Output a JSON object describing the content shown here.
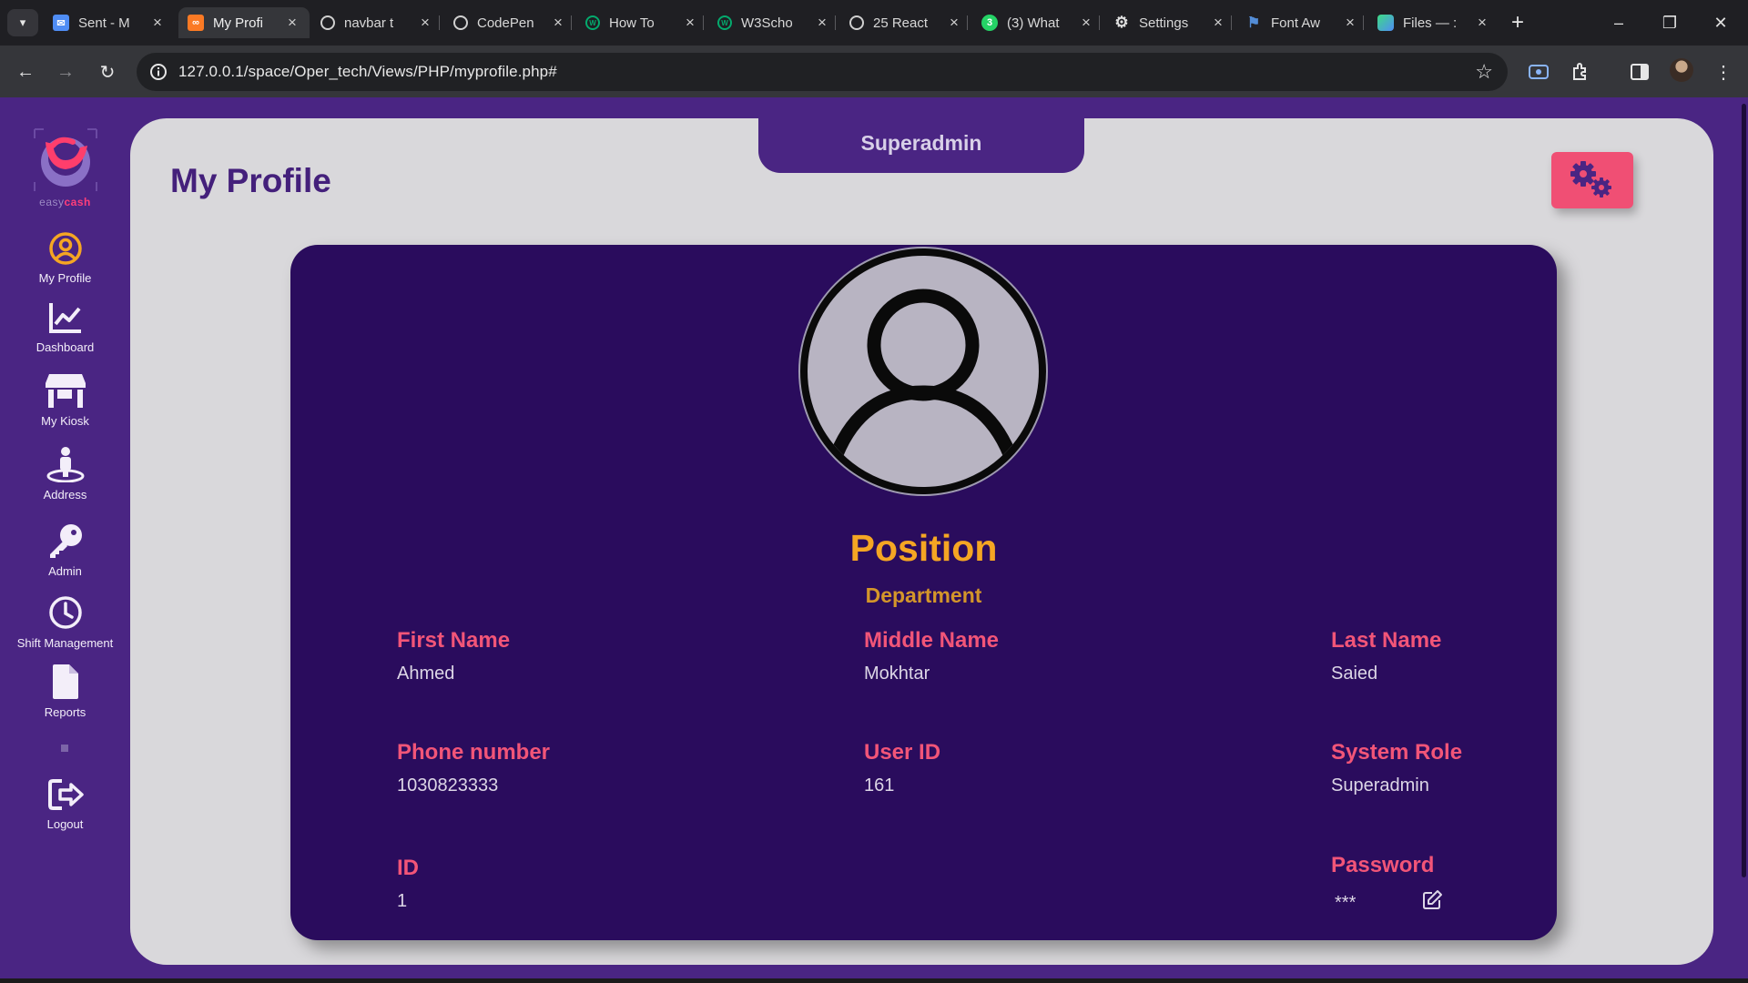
{
  "browser": {
    "tabs": [
      {
        "title": "Sent - M",
        "icon": "mail-icon",
        "color": "#4f8df5"
      },
      {
        "title": "My Profi",
        "icon": "xampp-icon",
        "color": "#fb7a24",
        "active": true
      },
      {
        "title": "navbar t",
        "icon": "codepen-icon",
        "color": "#d0d0d0"
      },
      {
        "title": "CodePen",
        "icon": "chatgpt-icon",
        "color": "#d0d0d0"
      },
      {
        "title": "How To",
        "icon": "w3schools-icon",
        "color": "#04aa6d"
      },
      {
        "title": "W3Scho",
        "icon": "w3schools-icon",
        "color": "#04aa6d"
      },
      {
        "title": "25 React",
        "icon": "codepen-icon",
        "color": "#d0d0d0"
      },
      {
        "title": "(3) What",
        "icon": "whatsapp-icon",
        "color": "#25d366"
      },
      {
        "title": "Settings",
        "icon": "gear-icon",
        "color": "#d0d0d0"
      },
      {
        "title": "Font Aw",
        "icon": "flag-icon",
        "color": "#538dd7"
      },
      {
        "title": "Files — :",
        "icon": "files-icon",
        "color": "#3ddc84"
      }
    ],
    "url": "127.0.0.1/space/Oper_tech/Views/PHP/myprofile.php#"
  },
  "brand": {
    "easy": "easy",
    "cash": "cash"
  },
  "sidebar": {
    "items": [
      {
        "label": "My Profile",
        "icon": "user-circle-icon"
      },
      {
        "label": "Dashboard",
        "icon": "chart-line-icon"
      },
      {
        "label": "My Kiosk",
        "icon": "store-icon"
      },
      {
        "label": "Address",
        "icon": "street-view-icon"
      },
      {
        "label": "Admin",
        "icon": "key-icon"
      },
      {
        "label": "Shift Management",
        "icon": "clock-icon"
      },
      {
        "label": "Reports",
        "icon": "file-icon"
      },
      {
        "label": "Logout",
        "icon": "logout-icon"
      }
    ]
  },
  "header": {
    "page_title": "My Profile",
    "role_tab": "Superadmin"
  },
  "profile": {
    "position": "Position",
    "department": "Department",
    "fields": {
      "first_name": {
        "label": "First Name",
        "value": "Ahmed"
      },
      "middle_name": {
        "label": "Middle Name",
        "value": "Mokhtar"
      },
      "last_name": {
        "label": "Last Name",
        "value": "Saied"
      },
      "phone": {
        "label": "Phone number",
        "value": "1030823333"
      },
      "user_id": {
        "label": "User ID",
        "value": "161"
      },
      "system_role": {
        "label": "System Role",
        "value": "Superadmin"
      },
      "id": {
        "label": "ID",
        "value": "1"
      },
      "password": {
        "label": "Password",
        "value": "***"
      }
    }
  },
  "colors": {
    "sidebar_bg": "#4a2583",
    "card_bg": "#2a0c5d",
    "accent_pink": "#f25578",
    "accent_orange": "#f5a623",
    "panel_bg": "#d9d8db"
  }
}
